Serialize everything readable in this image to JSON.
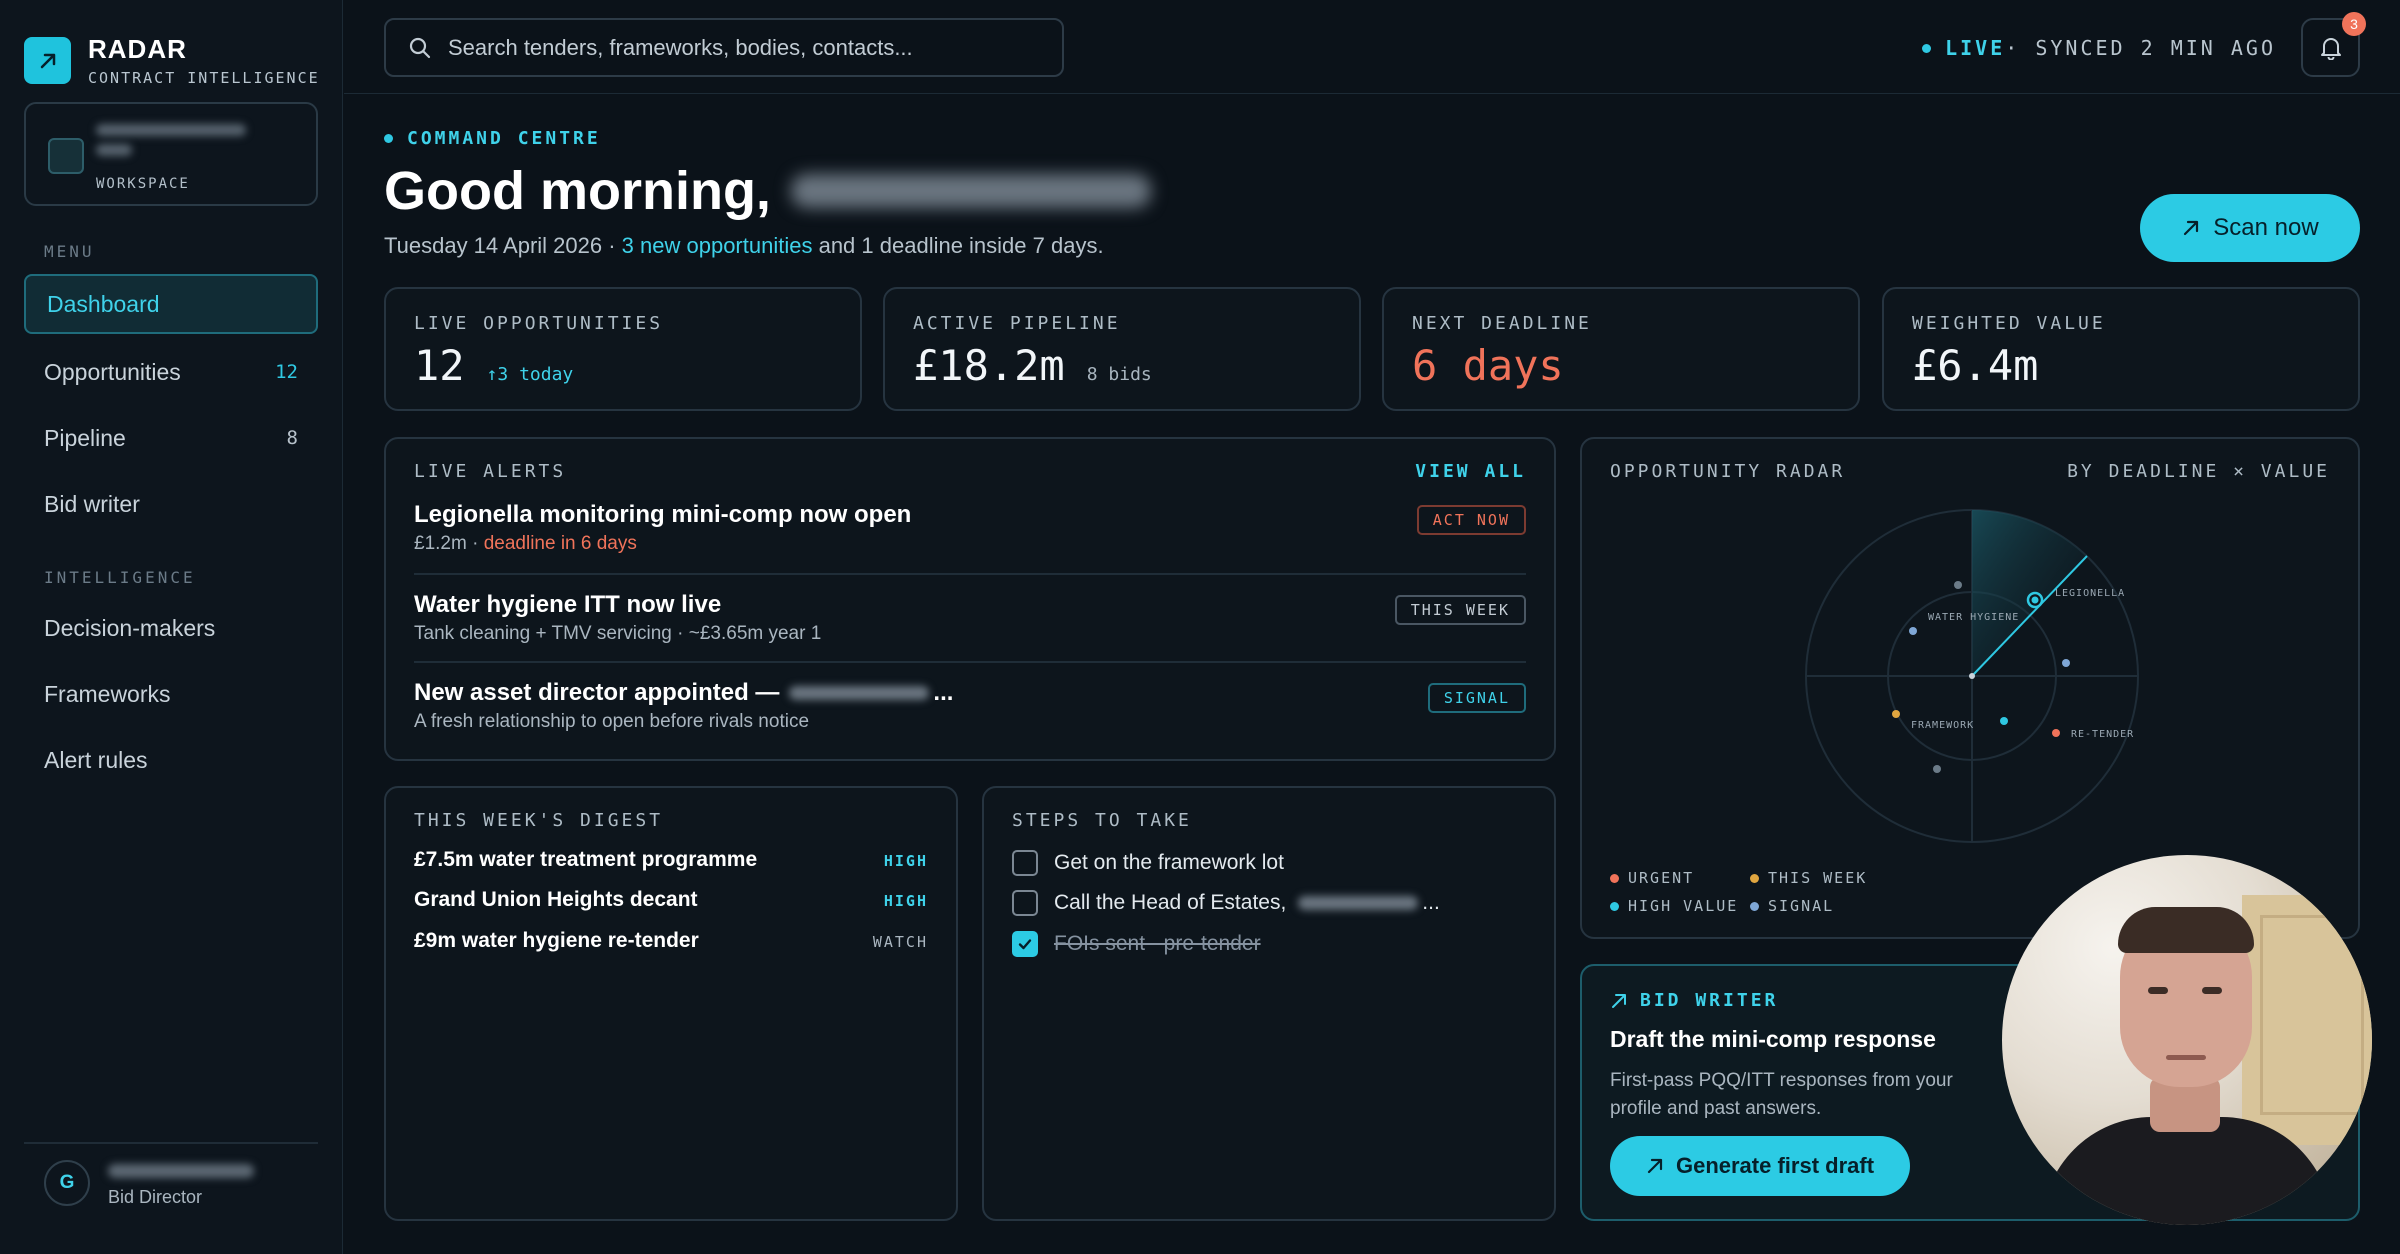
{
  "brand": {
    "name": "RADAR",
    "subtitle": "CONTRACT INTELLIGENCE"
  },
  "workspace": {
    "label": "WORKSPACE"
  },
  "sidebar": {
    "menu_title": "MENU",
    "menu": [
      {
        "label": "Dashboard",
        "count": ""
      },
      {
        "label": "Opportunities",
        "count": "12"
      },
      {
        "label": "Pipeline",
        "count": "8"
      },
      {
        "label": "Bid writer",
        "count": ""
      }
    ],
    "intel_title": "INTELLIGENCE",
    "intelligence": [
      {
        "label": "Decision-makers"
      },
      {
        "label": "Frameworks"
      },
      {
        "label": "Alert rules"
      }
    ],
    "user": {
      "initial": "G",
      "role": "Bid Director"
    }
  },
  "topbar": {
    "search_placeholder": "Search tenders, frameworks, bodies, contacts...",
    "live": "LIVE",
    "synced": " · SYNCED 2 MIN AGO",
    "notifications": "3"
  },
  "header": {
    "eyebrow": "COMMAND CENTRE",
    "greeting": "Good morning,",
    "date": "Tuesday 14 April 2026 · ",
    "link": "3 new opportunities",
    "rest": " and 1 deadline inside 7 days.",
    "scan_button": "Scan now"
  },
  "stats": [
    {
      "label": "LIVE OPPORTUNITIES",
      "value": "12",
      "extra": "↑3 today"
    },
    {
      "label": "ACTIVE PIPELINE",
      "value": "£18.2m",
      "extra": "8 bids"
    },
    {
      "label": "NEXT DEADLINE",
      "value": "6 days",
      "extra": ""
    },
    {
      "label": "WEIGHTED VALUE",
      "value": "£6.4m",
      "extra": ""
    }
  ],
  "alerts": {
    "title": "LIVE ALERTS",
    "view_all": "VIEW ALL",
    "items": [
      {
        "title": "Legionella monitoring mini-comp now open",
        "sub_a": "£1.2m · ",
        "sub_b": "deadline in 6 days",
        "tag": "ACT NOW"
      },
      {
        "title": "Water hygiene ITT now live",
        "sub_a": "Tank cleaning + TMV servicing · ~£3.65m year 1",
        "sub_b": "",
        "tag": "THIS WEEK"
      },
      {
        "title": "New asset director appointed —",
        "title_end": "...",
        "sub_a": "A fresh relationship to open before rivals notice",
        "sub_b": "",
        "tag": "SIGNAL"
      }
    ]
  },
  "digest": {
    "title": "THIS WEEK'S DIGEST",
    "items": [
      {
        "label": "£7.5m water treatment programme",
        "level": "HIGH"
      },
      {
        "label": "Grand Union Heights decant",
        "level": "HIGH"
      },
      {
        "label": "£9m water hygiene re-tender",
        "level": "WATCH"
      }
    ]
  },
  "steps": {
    "title": "STEPS TO TAKE",
    "items": [
      {
        "label": "Get on the framework lot",
        "done": false,
        "tail": ""
      },
      {
        "label": "Call the Head of Estates,",
        "done": false,
        "tail": "..."
      },
      {
        "label": "FOIs sent - pre-tender",
        "done": true,
        "tail": ""
      }
    ]
  },
  "radar": {
    "title": "OPPORTUNITY RADAR",
    "subtitle": "BY DEADLINE × VALUE",
    "labels": {
      "legionella": "LEGIONELLA",
      "water_hygiene": "WATER HYGIENE",
      "framework": "FRAMEWORK",
      "re_tender": "RE-TENDER"
    },
    "legend": [
      {
        "label": "URGENT",
        "color": "#f0735a"
      },
      {
        "label": "THIS WEEK",
        "color": "#e0a640"
      },
      {
        "label": "HIGH VALUE",
        "color": "#2fc8e2"
      },
      {
        "label": "SIGNAL",
        "color": "#7fa7d6"
      }
    ]
  },
  "bid_writer": {
    "title": "BID WRITER",
    "heading": "Draft the mini-comp response",
    "description": "First-pass PQQ/ITT responses from your profile and past answers.",
    "button": "Generate first draft"
  },
  "colors": {
    "accent": "#2ccbe4",
    "urgent": "#f0735a",
    "background": "#0b1219"
  }
}
